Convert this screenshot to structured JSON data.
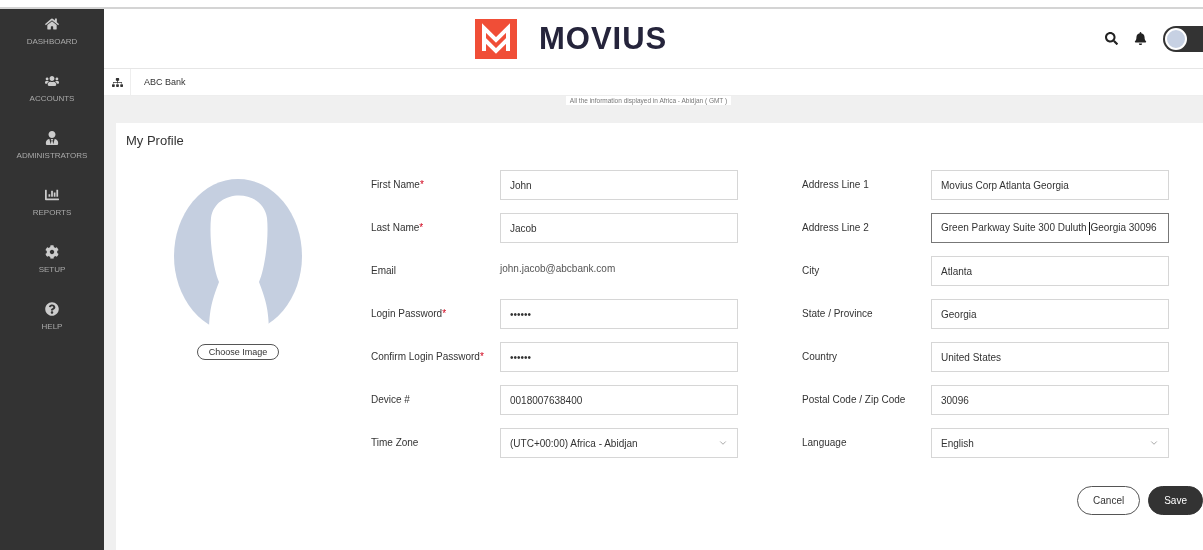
{
  "sidebar": {
    "items": [
      {
        "label": "DASHBOARD"
      },
      {
        "label": "ACCOUNTS"
      },
      {
        "label": "ADMINISTRATORS"
      },
      {
        "label": "REPORTS"
      },
      {
        "label": "SETUP"
      },
      {
        "label": "HELP"
      }
    ]
  },
  "header": {
    "logo_text": "MOVIUS"
  },
  "breadcrumb": {
    "label": "ABC Bank"
  },
  "timezone_notice": "All the information displayed in Africa - Abidjan ( GMT )",
  "profile": {
    "title": "My Profile",
    "choose_image": "Choose Image",
    "left_fields": [
      {
        "label": "First Name",
        "required_mark": "*",
        "kind": "input",
        "value": "John"
      },
      {
        "label": "Last Name",
        "required_mark": "*",
        "kind": "input",
        "value": "Jacob"
      },
      {
        "label": "Email",
        "kind": "text",
        "value": "john.jacob@abcbank.com"
      },
      {
        "label": "Login Password",
        "required_mark": "*",
        "kind": "input",
        "value": "••••••"
      },
      {
        "label": "Confirm Login Password",
        "required_mark": "*",
        "kind": "input",
        "value": "••••••"
      },
      {
        "label": "Device #",
        "kind": "input",
        "value": "0018007638400"
      },
      {
        "label": "Time Zone",
        "kind": "select",
        "value": "(UTC+00:00) Africa - Abidjan"
      }
    ],
    "right_fields": [
      {
        "label": "Address Line 1",
        "kind": "input",
        "value": "Movius Corp Atlanta Georgia",
        "focused": false
      },
      {
        "label": "Address Line 2",
        "kind": "input",
        "value": "Green Parkway Suite 300 Duluth Georgia 30096",
        "focused": true
      },
      {
        "label": "City",
        "kind": "input",
        "value": "Atlanta",
        "focused": false
      },
      {
        "label": "State / Province",
        "kind": "input",
        "value": "Georgia",
        "focused": false
      },
      {
        "label": "Country",
        "kind": "input",
        "value": "United States",
        "focused": false
      },
      {
        "label": "Postal Code / Zip Code",
        "kind": "input",
        "value": "30096",
        "focused": false
      },
      {
        "label": "Language",
        "kind": "select",
        "value": "English",
        "focused": false
      }
    ],
    "buttons": [
      {
        "label": "Cancel",
        "kind": "secondary"
      },
      {
        "label": "Save",
        "kind": "primary"
      }
    ]
  }
}
